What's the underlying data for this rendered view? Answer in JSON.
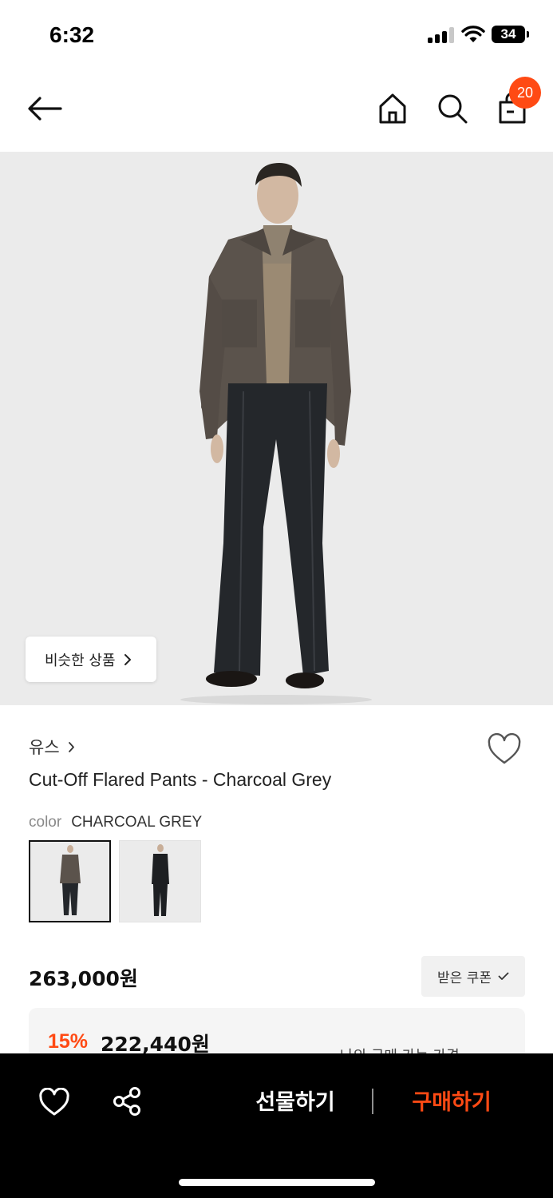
{
  "status_bar": {
    "time": "6:32",
    "battery": "34"
  },
  "header": {
    "cart_count": "20"
  },
  "hero": {
    "similar_label": "비슷한 상품"
  },
  "product": {
    "brand": "유스",
    "title": "Cut-Off Flared Pants - Charcoal Grey",
    "color_key": "color",
    "color_value": "CHARCOAL GREY",
    "price": "263,000원",
    "coupon_label": "받은 쿠폰",
    "discount_rate": "15%",
    "discount_price": "222,440원",
    "discount_note": "나의 구매 가능 가격"
  },
  "bottom_bar": {
    "gift_label": "선물하기",
    "buy_label": "구매하기"
  },
  "colors": {
    "accent": "#ff4a14",
    "bottom_bar": "#000000",
    "hero_bg": "#ebebeb"
  },
  "icons": [
    "back-arrow-icon",
    "home-icon",
    "search-icon",
    "shopping-bag-icon",
    "heart-icon",
    "share-icon",
    "chevron-right-icon",
    "check-icon",
    "chevron-down-icon"
  ]
}
